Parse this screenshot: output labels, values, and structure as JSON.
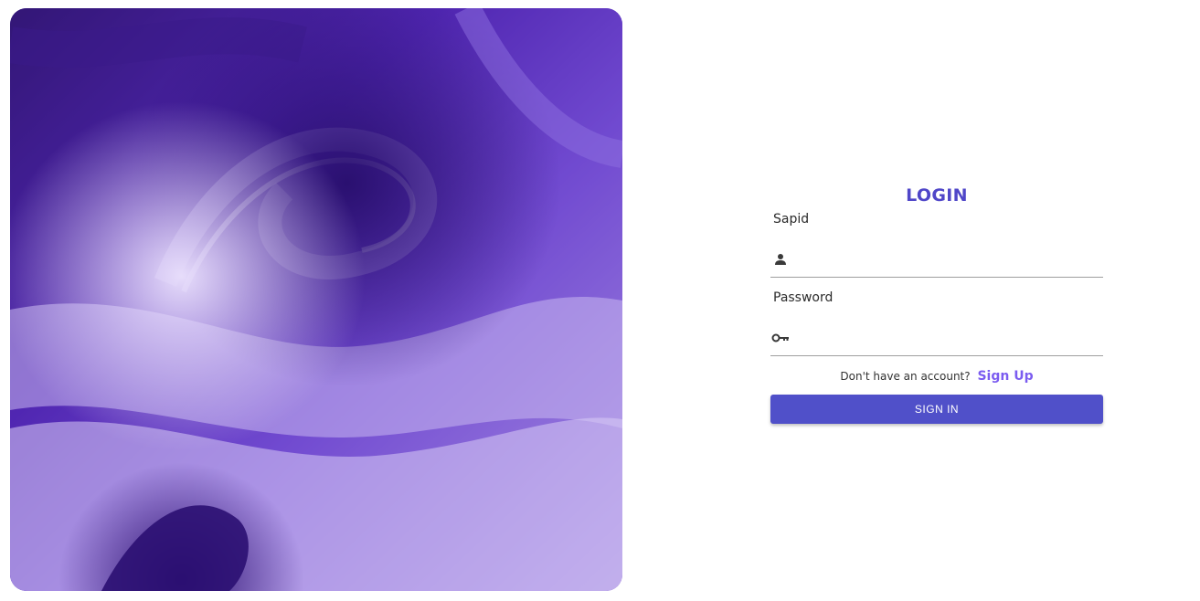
{
  "login": {
    "title": "LOGIN",
    "sapid_label": "Sapid",
    "sapid_value": "",
    "password_label": "Password",
    "password_value": "",
    "signup_prompt": "Don't have an account?",
    "signup_link": "Sign Up",
    "signin_button": "SIGN IN"
  },
  "icons": {
    "sapid": "person-icon",
    "password": "key-icon"
  },
  "colors": {
    "accent": "#5050c9",
    "title": "#4f46c8",
    "link": "#7b5cf0",
    "hero_base": "#5b2fc4"
  }
}
